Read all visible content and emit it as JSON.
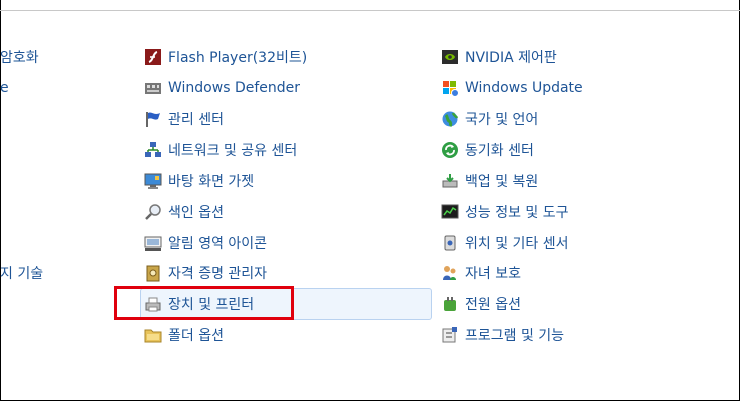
{
  "left_fragments": [
    "암호화",
    "e",
    "지 기술"
  ],
  "col1": [
    {
      "label": "Flash Player(32비트)",
      "icon": "flash-icon"
    },
    {
      "label": "Windows Defender",
      "icon": "defender-icon"
    },
    {
      "label": "관리 센터",
      "icon": "flag-icon"
    },
    {
      "label": "네트워크 및 공유 센터",
      "icon": "network-icon"
    },
    {
      "label": "바탕 화면 가젯",
      "icon": "gadget-icon"
    },
    {
      "label": "색인 옵션",
      "icon": "index-search-icon"
    },
    {
      "label": "알림 영역 아이콘",
      "icon": "notification-area-icon"
    },
    {
      "label": "자격 증명 관리자",
      "icon": "credential-safe-icon"
    },
    {
      "label": "장치 및 프린터",
      "icon": "printer-icon"
    },
    {
      "label": "폴더 옵션",
      "icon": "folder-icon"
    }
  ],
  "col2": [
    {
      "label": "NVIDIA 제어판",
      "icon": "nvidia-icon"
    },
    {
      "label": "Windows Update",
      "icon": "windows-update-icon"
    },
    {
      "label": "국가 및 언어",
      "icon": "globe-icon"
    },
    {
      "label": "동기화 센터",
      "icon": "sync-icon"
    },
    {
      "label": "백업 및 복원",
      "icon": "backup-icon"
    },
    {
      "label": "성능 정보 및 도구",
      "icon": "performance-icon"
    },
    {
      "label": "위치 및 기타 센서",
      "icon": "sensor-icon"
    },
    {
      "label": "자녀 보호",
      "icon": "parental-control-icon"
    },
    {
      "label": "전원 옵션",
      "icon": "power-icon"
    },
    {
      "label": "프로그램 및 기능",
      "icon": "programs-icon"
    }
  ],
  "highlight": {
    "color": "#e0000d"
  },
  "link_color": "#1e5496"
}
